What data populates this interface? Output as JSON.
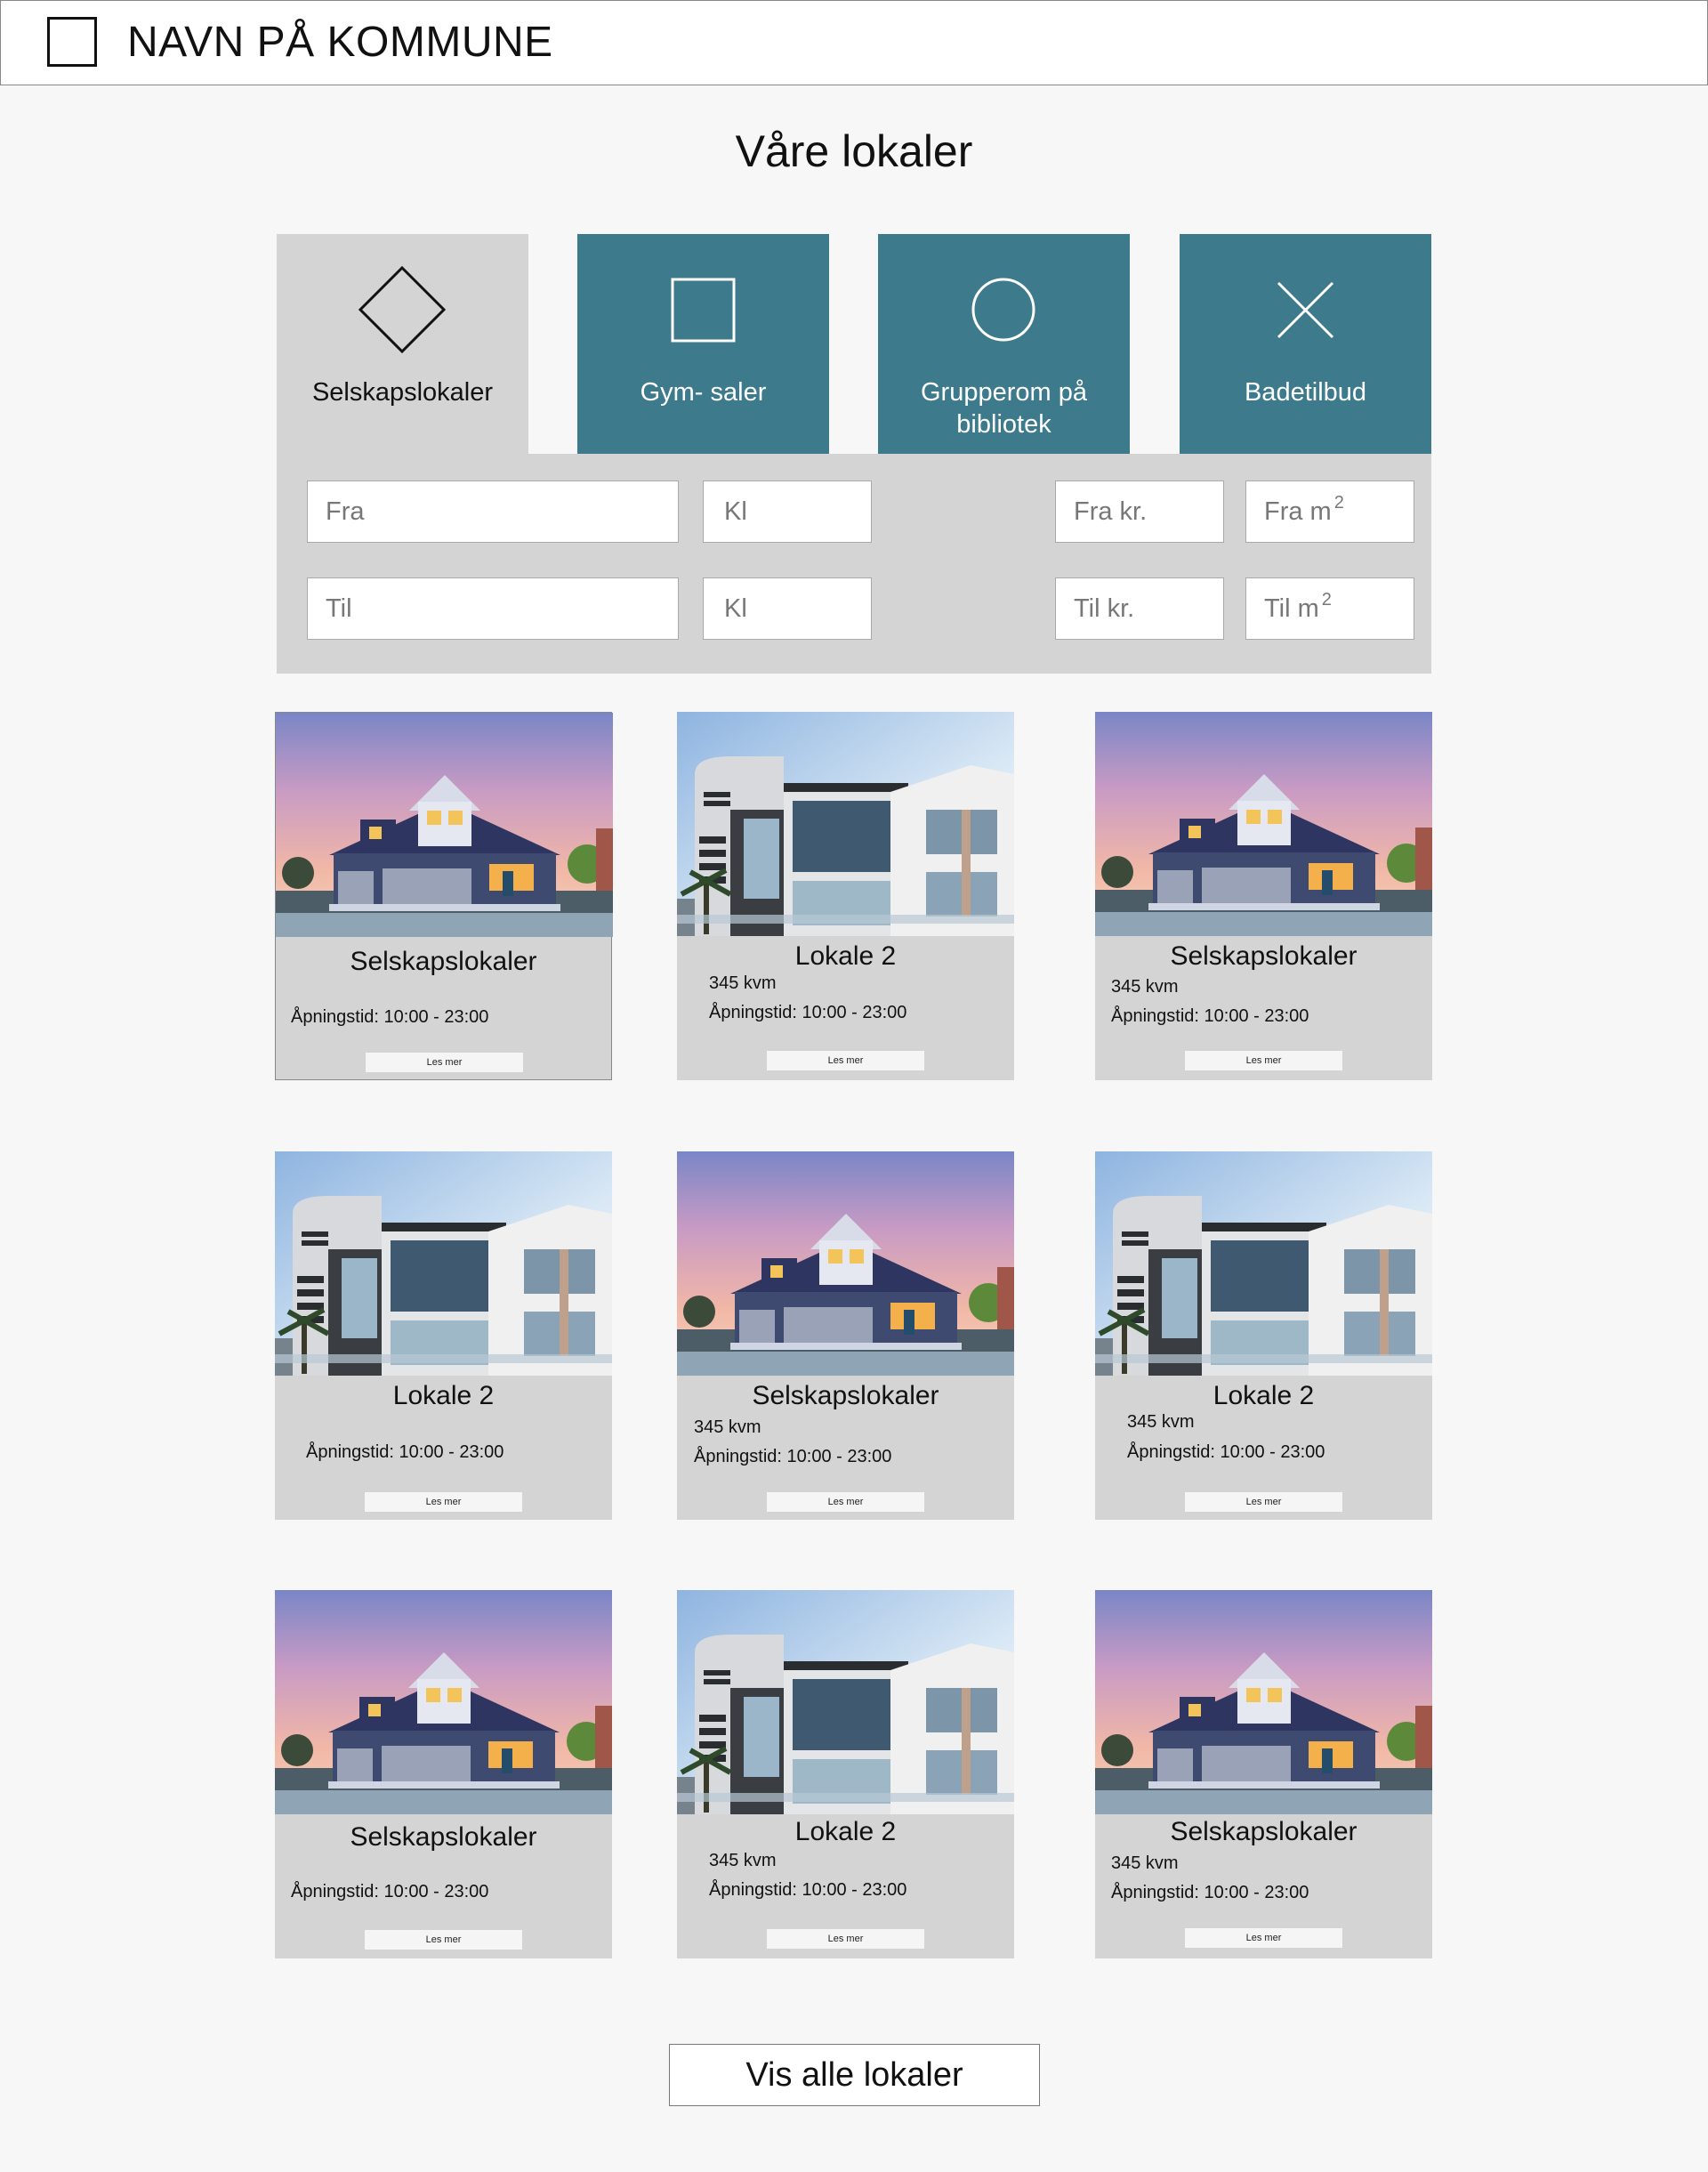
{
  "header": {
    "site_name": "NAVN PÅ KOMMUNE"
  },
  "page_title": "Våre lokaler",
  "tabs": [
    {
      "label": "Selskapslokaler",
      "icon": "diamond-icon",
      "active": true
    },
    {
      "label": "Gym- saler",
      "icon": "square-icon",
      "active": false
    },
    {
      "label": "Grupperom på bibliotek",
      "icon": "circle-icon",
      "active": false
    },
    {
      "label": "Badetilbud",
      "icon": "x-icon",
      "active": false
    }
  ],
  "filters": {
    "from_date": "Fra",
    "to_date": "Til",
    "from_time": "Kl",
    "to_time": "Kl",
    "from_price": "Fra kr.",
    "to_price": "Til kr.",
    "from_area": "Fra m",
    "to_area": "Til m",
    "area_sup": "2"
  },
  "cards": [
    {
      "title": "Selskapslokaler",
      "size": "",
      "hours": "Åpningstid:  10:00 - 23:00",
      "button": "Les mer",
      "image": "house-image"
    },
    {
      "title": "Lokale 2",
      "size": "345 kvm",
      "hours": "Åpningstid:  10:00 - 23:00",
      "button": "Les mer",
      "image": "modern-building-image"
    },
    {
      "title": "Selskapslokaler",
      "size": "345 kvm",
      "hours": "Åpningstid:  10:00 - 23:00",
      "button": "Les mer",
      "image": "house-image"
    },
    {
      "title": "Lokale 2",
      "size": "",
      "hours": "Åpningstid:  10:00 - 23:00",
      "button": "Les mer",
      "image": "modern-building-image"
    },
    {
      "title": "Selskapslokaler",
      "size": "345 kvm",
      "hours": "Åpningstid:  10:00 - 23:00",
      "button": "Les mer",
      "image": "house-image"
    },
    {
      "title": "Lokale 2",
      "size": "345 kvm",
      "hours": "Åpningstid:  10:00 - 23:00",
      "button": "Les mer",
      "image": "modern-building-image"
    },
    {
      "title": "Selskapslokaler",
      "size": "",
      "hours": "Åpningstid:  10:00 - 23:00",
      "button": "Les mer",
      "image": "house-image"
    },
    {
      "title": "Lokale 2",
      "size": "345 kvm",
      "hours": "Åpningstid:  10:00 - 23:00",
      "button": "Les mer",
      "image": "modern-building-image"
    },
    {
      "title": "Selskapslokaler",
      "size": "345 kvm",
      "hours": "Åpningstid:  10:00 - 23:00",
      "button": "Les mer",
      "image": "house-image"
    }
  ],
  "show_all_button": "Vis alle lokaler",
  "colors": {
    "tab_active": "#d4d4d4",
    "tab_inactive": "#3c7a8c",
    "panel": "#d4d4d4",
    "page_bg": "#f7f7f7"
  }
}
